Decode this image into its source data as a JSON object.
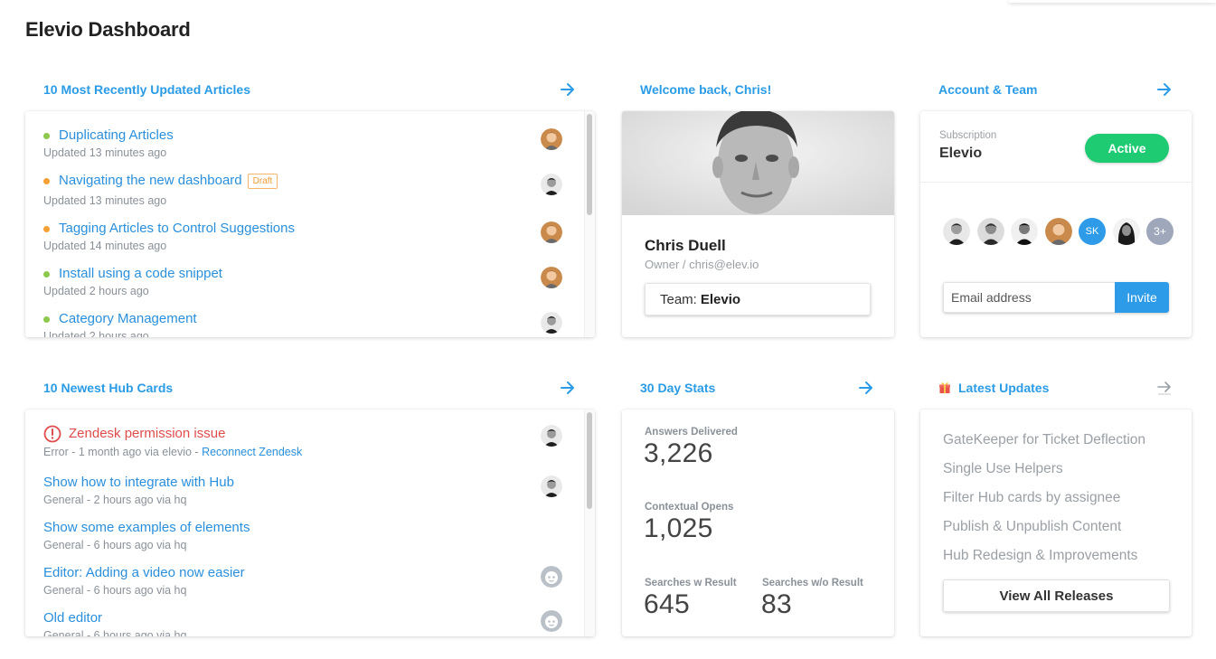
{
  "page_title": "Elevio Dashboard",
  "colors": {
    "link": "#2a8fdc",
    "heading": "#2a9be6",
    "active": "#1ecb72",
    "error": "#e04b4b",
    "invite": "#2d9be8"
  },
  "articles": {
    "title": "10 Most Recently Updated Articles",
    "draft_label": "Draft",
    "items": [
      {
        "title": "Duplicating Articles",
        "updated": "Updated 13 minutes ago",
        "status": "green",
        "avatar": "curly"
      },
      {
        "title": "Navigating the new dashboard",
        "updated": "Updated 13 minutes ago",
        "status": "orange",
        "avatar": "bw"
      },
      {
        "title": "Tagging Articles to Control Suggestions",
        "updated": "Updated 14 minutes ago",
        "status": "orange",
        "avatar": "curly"
      },
      {
        "title": "Install using a code snippet",
        "updated": "Updated 2 hours ago",
        "status": "green",
        "avatar": "curly"
      },
      {
        "title": "Category Management",
        "updated": "Updated 2 hours ago",
        "status": "green",
        "avatar": "bw"
      }
    ]
  },
  "welcome": {
    "title": "Welcome back, Chris!",
    "name": "Chris Duell",
    "role": "Owner / chris@elev.io",
    "team_prefix": "Team:",
    "team_name": "Elevio"
  },
  "account": {
    "title": "Account & Team",
    "subscription_label": "Subscription",
    "subscription_name": "Elevio",
    "status_label": "Active",
    "members_initials": "SK",
    "members_more": "3+",
    "email_placeholder": "Email address",
    "invite_label": "Invite"
  },
  "hub_cards": {
    "title": "10 Newest Hub Cards",
    "items": [
      {
        "title": "Zendesk permission issue",
        "meta": "Error - 1 month ago via elevio - ",
        "link": "Reconnect Zendesk",
        "error": true,
        "avatar": "bw"
      },
      {
        "title": "Show how to integrate with Hub",
        "meta": "General - 2 hours ago via hq",
        "avatar": "bw"
      },
      {
        "title": "Show some examples of elements",
        "meta": "General - 6 hours ago via hq",
        "avatar": ""
      },
      {
        "title": "Editor: Adding a video now easier",
        "meta": "General - 6 hours ago via hq",
        "avatar": "bot"
      },
      {
        "title": "Old editor",
        "meta": "General - 6 hours ago via hq",
        "avatar": "bot"
      }
    ]
  },
  "stats": {
    "title": "30 Day Stats",
    "answers_label": "Answers Delivered",
    "answers_value": "3,226",
    "contextual_label": "Contextual Opens",
    "contextual_value": "1,025",
    "search_result_label": "Searches w Result",
    "search_result_value": "645",
    "search_no_result_label": "Searches w/o Result",
    "search_no_result_value": "83"
  },
  "updates": {
    "title": "Latest Updates",
    "items": [
      "GateKeeper for Ticket Deflection",
      "Single Use Helpers",
      "Filter Hub cards by assignee",
      "Publish & Unpublish Content",
      "Hub Redesign & Improvements"
    ],
    "view_all_label": "View All Releases"
  }
}
